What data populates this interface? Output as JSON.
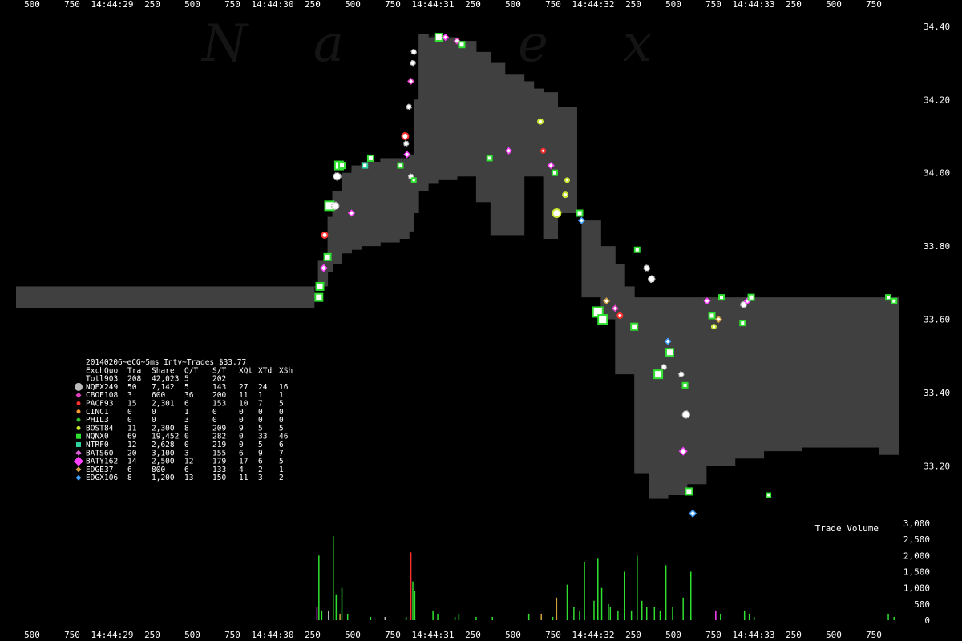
{
  "chart_data": {
    "type": "scatter",
    "watermark": [
      "N",
      "a",
      "n",
      "e",
      "x"
    ],
    "time_axis": {
      "labels": [
        "500",
        "750",
        "14:44:29",
        "250",
        "500",
        "750",
        "14:44:30",
        "250",
        "500",
        "750",
        "14:44:31",
        "250",
        "500",
        "750",
        "14:44:32",
        "250",
        "500",
        "750",
        "14:44:33",
        "250",
        "500",
        "750"
      ]
    },
    "price_axis": {
      "ticks": [
        "33.20",
        "33.40",
        "33.60",
        "33.80",
        "34.00",
        "34.20",
        "34.40"
      ],
      "range": [
        33.05,
        34.45
      ]
    },
    "volume_axis": {
      "title": "Trade Volume",
      "ticks": [
        "0",
        "500",
        "1,000",
        "1,500",
        "2,000",
        "2,500",
        "3,000"
      ],
      "range": [
        0,
        3000
      ]
    },
    "nbbo_band": [
      {
        "t": 0.0,
        "low": 33.63,
        "high": 33.69
      },
      {
        "t": 3.11,
        "low": 33.63,
        "high": 33.69
      },
      {
        "t": 3.11,
        "low": 33.69,
        "high": 33.69
      },
      {
        "t": 3.15,
        "low": 33.69,
        "high": 33.76
      },
      {
        "t": 3.25,
        "low": 33.73,
        "high": 33.88
      },
      {
        "t": 3.3,
        "low": 33.75,
        "high": 33.95
      },
      {
        "t": 3.4,
        "low": 33.78,
        "high": 34.0
      },
      {
        "t": 3.5,
        "low": 33.79,
        "high": 34.02
      },
      {
        "t": 3.6,
        "low": 33.8,
        "high": 34.03
      },
      {
        "t": 3.8,
        "low": 33.81,
        "high": 34.04
      },
      {
        "t": 4.0,
        "low": 33.82,
        "high": 34.04
      },
      {
        "t": 4.1,
        "low": 33.84,
        "high": 34.05
      },
      {
        "t": 4.15,
        "low": 33.89,
        "high": 34.2
      },
      {
        "t": 4.2,
        "low": 33.95,
        "high": 34.38
      },
      {
        "t": 4.3,
        "low": 33.97,
        "high": 34.37
      },
      {
        "t": 4.4,
        "low": 33.98,
        "high": 34.37
      },
      {
        "t": 4.6,
        "low": 33.99,
        "high": 34.36
      },
      {
        "t": 4.8,
        "low": 33.92,
        "high": 34.33
      },
      {
        "t": 4.95,
        "low": 33.83,
        "high": 34.3
      },
      {
        "t": 5.1,
        "low": 33.83,
        "high": 34.27
      },
      {
        "t": 5.3,
        "low": 33.99,
        "high": 34.25
      },
      {
        "t": 5.4,
        "low": 33.99,
        "high": 34.23
      },
      {
        "t": 5.5,
        "low": 33.82,
        "high": 34.22
      },
      {
        "t": 5.65,
        "low": 33.89,
        "high": 34.18
      },
      {
        "t": 5.8,
        "low": 33.89,
        "high": 34.18
      },
      {
        "t": 5.85,
        "low": 33.89,
        "high": 33.89
      },
      {
        "t": 5.9,
        "low": 33.66,
        "high": 33.87
      },
      {
        "t": 6.1,
        "low": 33.6,
        "high": 33.8
      },
      {
        "t": 6.25,
        "low": 33.45,
        "high": 33.75
      },
      {
        "t": 6.35,
        "low": 33.45,
        "high": 33.69
      },
      {
        "t": 6.45,
        "low": 33.18,
        "high": 33.66
      },
      {
        "t": 6.6,
        "low": 33.11,
        "high": 33.66
      },
      {
        "t": 6.8,
        "low": 33.12,
        "high": 33.66
      },
      {
        "t": 7.0,
        "low": 33.15,
        "high": 33.66
      },
      {
        "t": 7.2,
        "low": 33.2,
        "high": 33.66
      },
      {
        "t": 7.5,
        "low": 33.22,
        "high": 33.66
      },
      {
        "t": 7.8,
        "low": 33.24,
        "high": 33.66
      },
      {
        "t": 8.2,
        "low": 33.25,
        "high": 33.66
      },
      {
        "t": 8.6,
        "low": 33.25,
        "high": 33.66
      },
      {
        "t": 9.0,
        "low": 33.23,
        "high": 33.66
      },
      {
        "t": 9.2,
        "low": 33.23,
        "high": 33.66
      }
    ],
    "trades": [
      {
        "t": 3.16,
        "p": 33.66,
        "exch": "NQNX",
        "sz": 9
      },
      {
        "t": 3.17,
        "p": 33.69,
        "exch": "NQNX",
        "sz": 9
      },
      {
        "t": 3.21,
        "p": 33.74,
        "exch": "BATY",
        "sz": 6
      },
      {
        "t": 3.22,
        "p": 33.83,
        "exch": "PACF",
        "sz": 7
      },
      {
        "t": 3.25,
        "p": 33.77,
        "exch": "NQNX",
        "sz": 8
      },
      {
        "t": 3.27,
        "p": 33.91,
        "exch": "NQNX",
        "sz": 11
      },
      {
        "t": 3.33,
        "p": 33.91,
        "exch": "NQEX",
        "sz": 9
      },
      {
        "t": 3.35,
        "p": 33.99,
        "exch": "NQEX",
        "sz": 9
      },
      {
        "t": 3.37,
        "p": 34.02,
        "exch": "NQNX",
        "sz": 10
      },
      {
        "t": 3.4,
        "p": 34.02,
        "exch": "NQNX",
        "sz": 7
      },
      {
        "t": 3.5,
        "p": 33.89,
        "exch": "BATY",
        "sz": 5
      },
      {
        "t": 3.64,
        "p": 34.02,
        "exch": "NTRF",
        "sz": 6
      },
      {
        "t": 3.7,
        "p": 34.04,
        "exch": "NQNX",
        "sz": 7
      },
      {
        "t": 4.01,
        "p": 34.02,
        "exch": "NQNX",
        "sz": 6
      },
      {
        "t": 4.06,
        "p": 34.1,
        "exch": "PACF",
        "sz": 8
      },
      {
        "t": 4.07,
        "p": 34.08,
        "exch": "NQEX",
        "sz": 6
      },
      {
        "t": 4.08,
        "p": 34.05,
        "exch": "BATY",
        "sz": 5
      },
      {
        "t": 4.1,
        "p": 34.18,
        "exch": "NQEX",
        "sz": 6
      },
      {
        "t": 4.12,
        "p": 34.25,
        "exch": "CBOE",
        "sz": 5
      },
      {
        "t": 4.14,
        "p": 34.3,
        "exch": "NQEX",
        "sz": 6
      },
      {
        "t": 4.15,
        "p": 34.33,
        "exch": "NQEX",
        "sz": 6
      },
      {
        "t": 4.12,
        "p": 33.99,
        "exch": "NQEX",
        "sz": 6
      },
      {
        "t": 4.15,
        "p": 33.98,
        "exch": "NQNX",
        "sz": 5
      },
      {
        "t": 4.41,
        "p": 34.37,
        "exch": "NQNX",
        "sz": 9
      },
      {
        "t": 4.48,
        "p": 34.37,
        "exch": "BATY",
        "sz": 5
      },
      {
        "t": 4.6,
        "p": 34.36,
        "exch": "CBOE",
        "sz": 5
      },
      {
        "t": 4.65,
        "p": 34.35,
        "exch": "NQNX",
        "sz": 7
      },
      {
        "t": 4.94,
        "p": 34.04,
        "exch": "NQNX",
        "sz": 6
      },
      {
        "t": 5.14,
        "p": 34.06,
        "exch": "BATY",
        "sz": 5
      },
      {
        "t": 5.47,
        "p": 34.14,
        "exch": "BOST",
        "sz": 6
      },
      {
        "t": 5.5,
        "p": 34.06,
        "exch": "PACF",
        "sz": 5
      },
      {
        "t": 5.58,
        "p": 34.02,
        "exch": "BATY",
        "sz": 5
      },
      {
        "t": 5.62,
        "p": 34.0,
        "exch": "NQNX",
        "sz": 6
      },
      {
        "t": 5.64,
        "p": 33.89,
        "exch": "BOST",
        "sz": 10
      },
      {
        "t": 5.73,
        "p": 33.94,
        "exch": "BOST",
        "sz": 6
      },
      {
        "t": 5.75,
        "p": 33.98,
        "exch": "BOST",
        "sz": 5
      },
      {
        "t": 5.88,
        "p": 33.89,
        "exch": "NQNX",
        "sz": 7
      },
      {
        "t": 5.9,
        "p": 33.87,
        "exch": "EDGX",
        "sz": 5
      },
      {
        "t": 6.07,
        "p": 33.62,
        "exch": "NQNX",
        "sz": 12
      },
      {
        "t": 6.12,
        "p": 33.6,
        "exch": "NQNX",
        "sz": 11
      },
      {
        "t": 6.16,
        "p": 33.65,
        "exch": "EDGE",
        "sz": 5
      },
      {
        "t": 6.25,
        "p": 33.63,
        "exch": "CBOE",
        "sz": 5
      },
      {
        "t": 6.3,
        "p": 33.61,
        "exch": "PACF",
        "sz": 6
      },
      {
        "t": 6.45,
        "p": 33.58,
        "exch": "NQNX",
        "sz": 8
      },
      {
        "t": 6.48,
        "p": 33.79,
        "exch": "NQNX",
        "sz": 6
      },
      {
        "t": 6.58,
        "p": 33.74,
        "exch": "NQEX",
        "sz": 7
      },
      {
        "t": 6.63,
        "p": 33.71,
        "exch": "NQEX",
        "sz": 8
      },
      {
        "t": 6.7,
        "p": 33.45,
        "exch": "NQNX",
        "sz": 10
      },
      {
        "t": 6.76,
        "p": 33.47,
        "exch": "NQEX",
        "sz": 6
      },
      {
        "t": 6.8,
        "p": 33.54,
        "exch": "EDGX",
        "sz": 5
      },
      {
        "t": 6.82,
        "p": 33.51,
        "exch": "NQNX",
        "sz": 9
      },
      {
        "t": 6.94,
        "p": 33.45,
        "exch": "NQEX",
        "sz": 6
      },
      {
        "t": 6.98,
        "p": 33.42,
        "exch": "NQNX",
        "sz": 6
      },
      {
        "t": 6.99,
        "p": 33.34,
        "exch": "NQEX",
        "sz": 9
      },
      {
        "t": 6.96,
        "p": 33.24,
        "exch": "BATY",
        "sz": 7
      },
      {
        "t": 7.02,
        "p": 33.13,
        "exch": "NQNX",
        "sz": 8
      },
      {
        "t": 7.06,
        "p": 33.07,
        "exch": "EDGX",
        "sz": 6
      },
      {
        "t": 7.26,
        "p": 33.61,
        "exch": "NQNX",
        "sz": 7
      },
      {
        "t": 7.28,
        "p": 33.58,
        "exch": "BOST",
        "sz": 5
      },
      {
        "t": 7.33,
        "p": 33.6,
        "exch": "EDGE",
        "sz": 5
      },
      {
        "t": 7.36,
        "p": 33.66,
        "exch": "NQNX",
        "sz": 6
      },
      {
        "t": 7.21,
        "p": 33.65,
        "exch": "BATY",
        "sz": 5
      },
      {
        "t": 7.58,
        "p": 33.59,
        "exch": "NQNX",
        "sz": 6
      },
      {
        "t": 7.59,
        "p": 33.64,
        "exch": "NQEX",
        "sz": 7
      },
      {
        "t": 7.63,
        "p": 33.65,
        "exch": "BATY",
        "sz": 5
      },
      {
        "t": 7.67,
        "p": 33.66,
        "exch": "NQNX",
        "sz": 7
      },
      {
        "t": 7.85,
        "p": 33.12,
        "exch": "NQNX",
        "sz": 5
      },
      {
        "t": 9.1,
        "p": 33.66,
        "exch": "NQNX",
        "sz": 6
      },
      {
        "t": 9.16,
        "p": 33.65,
        "exch": "NQNX",
        "sz": 6
      }
    ],
    "volume_bars": [
      {
        "t": 3.14,
        "v": 400,
        "exch": "BATY"
      },
      {
        "t": 3.16,
        "v": 2000,
        "exch": "NQNX"
      },
      {
        "t": 3.19,
        "v": 300,
        "exch": "NQNX"
      },
      {
        "t": 3.26,
        "v": 300,
        "exch": "NQEX"
      },
      {
        "t": 3.31,
        "v": 2600,
        "exch": "NQNX"
      },
      {
        "t": 3.34,
        "v": 800,
        "exch": "NQNX"
      },
      {
        "t": 3.38,
        "v": 200,
        "exch": "EDGE"
      },
      {
        "t": 3.4,
        "v": 1000,
        "exch": "NQNX"
      },
      {
        "t": 3.46,
        "v": 200,
        "exch": "NQNX"
      },
      {
        "t": 3.7,
        "v": 100,
        "exch": "NQNX"
      },
      {
        "t": 3.85,
        "v": 100,
        "exch": "NQEX"
      },
      {
        "t": 4.07,
        "v": 100,
        "exch": "NQNX"
      },
      {
        "t": 4.12,
        "v": 2100,
        "exch": "PACF"
      },
      {
        "t": 4.14,
        "v": 1200,
        "exch": "NQNX"
      },
      {
        "t": 4.16,
        "v": 900,
        "exch": "NQNX"
      },
      {
        "t": 4.35,
        "v": 300,
        "exch": "NQNX"
      },
      {
        "t": 4.4,
        "v": 200,
        "exch": "NQNX"
      },
      {
        "t": 4.58,
        "v": 100,
        "exch": "NQNX"
      },
      {
        "t": 4.62,
        "v": 200,
        "exch": "NQNX"
      },
      {
        "t": 4.8,
        "v": 100,
        "exch": "NQNX"
      },
      {
        "t": 4.97,
        "v": 100,
        "exch": "NQNX"
      },
      {
        "t": 5.35,
        "v": 200,
        "exch": "NQNX"
      },
      {
        "t": 5.48,
        "v": 200,
        "exch": "EDGE"
      },
      {
        "t": 5.6,
        "v": 100,
        "exch": "NQNX"
      },
      {
        "t": 5.64,
        "v": 700,
        "exch": "EDGE"
      },
      {
        "t": 5.75,
        "v": 1100,
        "exch": "NQNX"
      },
      {
        "t": 5.82,
        "v": 400,
        "exch": "NQNX"
      },
      {
        "t": 5.88,
        "v": 300,
        "exch": "NQNX"
      },
      {
        "t": 5.93,
        "v": 1800,
        "exch": "NQNX"
      },
      {
        "t": 6.03,
        "v": 600,
        "exch": "NQNX"
      },
      {
        "t": 6.07,
        "v": 1900,
        "exch": "NQNX"
      },
      {
        "t": 6.11,
        "v": 1000,
        "exch": "NQNX"
      },
      {
        "t": 6.18,
        "v": 500,
        "exch": "NQNX"
      },
      {
        "t": 6.2,
        "v": 400,
        "exch": "NQNX"
      },
      {
        "t": 6.28,
        "v": 300,
        "exch": "NQNX"
      },
      {
        "t": 6.35,
        "v": 1500,
        "exch": "NQNX"
      },
      {
        "t": 6.42,
        "v": 300,
        "exch": "NQNX"
      },
      {
        "t": 6.48,
        "v": 2000,
        "exch": "NQNX"
      },
      {
        "t": 6.53,
        "v": 600,
        "exch": "NQNX"
      },
      {
        "t": 6.58,
        "v": 400,
        "exch": "NQNX"
      },
      {
        "t": 6.66,
        "v": 400,
        "exch": "NQNX"
      },
      {
        "t": 6.72,
        "v": 300,
        "exch": "NQNX"
      },
      {
        "t": 6.78,
        "v": 1700,
        "exch": "NQNX"
      },
      {
        "t": 6.85,
        "v": 400,
        "exch": "NQNX"
      },
      {
        "t": 6.96,
        "v": 700,
        "exch": "NQNX"
      },
      {
        "t": 7.04,
        "v": 1500,
        "exch": "NQNX"
      },
      {
        "t": 7.3,
        "v": 300,
        "exch": "BATY"
      },
      {
        "t": 7.35,
        "v": 200,
        "exch": "NQNX"
      },
      {
        "t": 7.6,
        "v": 300,
        "exch": "NQNX"
      },
      {
        "t": 7.65,
        "v": 200,
        "exch": "NQNX"
      },
      {
        "t": 7.7,
        "v": 100,
        "exch": "NQNX"
      },
      {
        "t": 9.1,
        "v": 200,
        "exch": "NQNX"
      },
      {
        "t": 9.16,
        "v": 100,
        "exch": "NQNX"
      }
    ],
    "legend": {
      "title": "20140206~eCG~5ms Intv~Trades $33.77",
      "header": [
        "Exch",
        "Quo",
        "Tra",
        "Share",
        "Q/T",
        "S/T",
        "XQt",
        "XTd",
        "XSh"
      ],
      "total": [
        "Totl",
        "903",
        "208",
        "42,023",
        "5",
        "202",
        "",
        "",
        ""
      ],
      "rows": [
        {
          "name": "NQEX",
          "color": "#bbbbbb",
          "shape": "cloud",
          "cells": [
            "249",
            "50",
            "7,142",
            "5",
            "143",
            "27",
            "24",
            "16"
          ]
        },
        {
          "name": "CBOE",
          "color": "#e040c0",
          "shape": "diamond",
          "cells": [
            "108",
            "3",
            "600",
            "36",
            "200",
            "11",
            "1",
            "1"
          ]
        },
        {
          "name": "PACF",
          "color": "#ff3030",
          "shape": "circle",
          "cells": [
            "93",
            "15",
            "2,301",
            "6",
            "153",
            "10",
            "7",
            "5"
          ]
        },
        {
          "name": "CINC",
          "color": "#ff9a30",
          "shape": "circle",
          "cells": [
            "1",
            "0",
            "0",
            "1",
            "0",
            "0",
            "0",
            "0"
          ]
        },
        {
          "name": "PHIL",
          "color": "#30c030",
          "shape": "circle",
          "cells": [
            "3",
            "0",
            "0",
            "3",
            "0",
            "0",
            "0",
            "0"
          ]
        },
        {
          "name": "BOST",
          "color": "#c8e830",
          "shape": "circle",
          "cells": [
            "84",
            "11",
            "2,300",
            "8",
            "209",
            "9",
            "5",
            "5"
          ]
        },
        {
          "name": "NQNX",
          "color": "#30e030",
          "shape": "square",
          "cells": [
            "0",
            "69",
            "19,452",
            "0",
            "282",
            "0",
            "33",
            "46"
          ]
        },
        {
          "name": "NTRF",
          "color": "#30d0a0",
          "shape": "square",
          "cells": [
            "0",
            "12",
            "2,628",
            "0",
            "219",
            "0",
            "5",
            "6"
          ]
        },
        {
          "name": "BATS",
          "color": "#e060e0",
          "shape": "diamond",
          "cells": [
            "60",
            "20",
            "3,100",
            "3",
            "155",
            "6",
            "9",
            "7"
          ]
        },
        {
          "name": "BATY",
          "color": "#ff40ff",
          "shape": "diamond",
          "cells": [
            "162",
            "14",
            "2,500",
            "12",
            "179",
            "17",
            "6",
            "5"
          ]
        },
        {
          "name": "EDGE",
          "color": "#d0a040",
          "shape": "diamond",
          "cells": [
            "37",
            "6",
            "800",
            "6",
            "133",
            "4",
            "2",
            "1"
          ]
        },
        {
          "name": "EDGX",
          "color": "#40a0ff",
          "shape": "diamond",
          "cells": [
            "106",
            "8",
            "1,200",
            "13",
            "150",
            "11",
            "3",
            "2"
          ]
        }
      ]
    },
    "colors": {
      "background": "#000000",
      "band": "#404040",
      "text": "#ffffff",
      "grid_text": "#ffffff"
    }
  }
}
